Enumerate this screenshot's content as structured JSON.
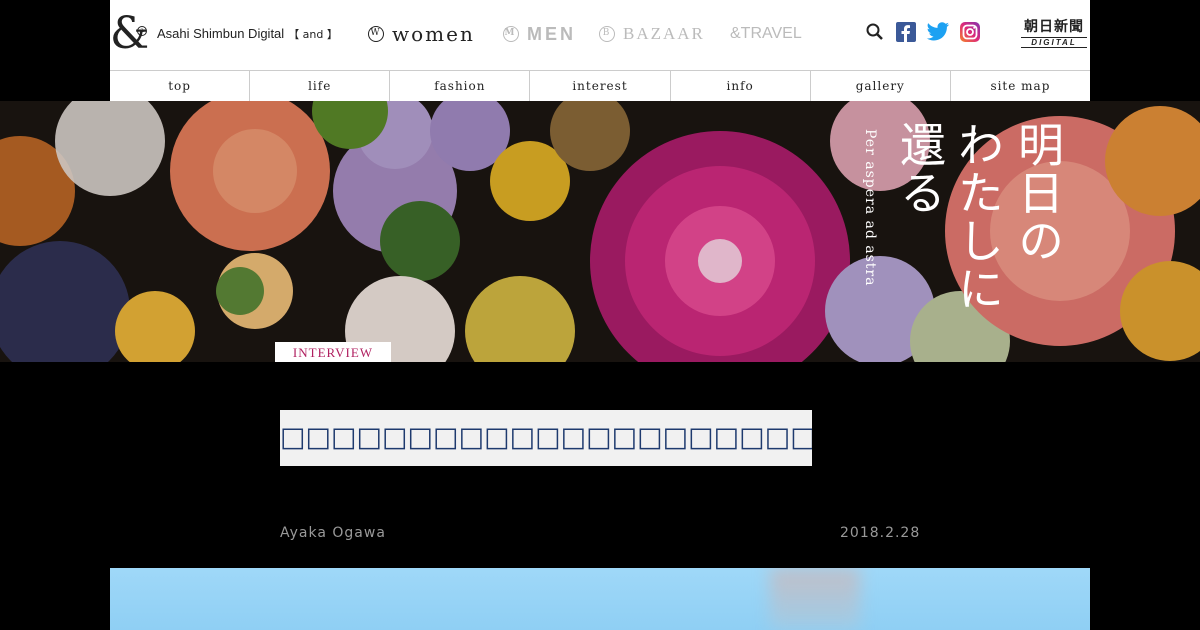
{
  "header": {
    "logo_glyph": "&",
    "logo_sub": "a",
    "brand": "Asahi Shimbun Digital",
    "brand_tag": "【 and 】",
    "sites": [
      {
        "label": "women",
        "badge": "W",
        "active": true
      },
      {
        "label": "MEN",
        "badge": "M",
        "active": false
      },
      {
        "label": "BAZAAR",
        "badge": "B",
        "active": false
      },
      {
        "label": "&TRAVEL",
        "active": false
      }
    ],
    "icons": [
      "search-icon",
      "facebook-icon",
      "twitter-icon",
      "instagram-icon"
    ],
    "asahi_logo": "朝日新聞",
    "asahi_sub": "DIGITAL"
  },
  "nav": {
    "items": [
      "top",
      "life",
      "fashion",
      "interest",
      "info",
      "gallery",
      "site map"
    ]
  },
  "hero": {
    "title_lines": [
      "明日の",
      "わたしに",
      "還る"
    ],
    "subtitle": "Per aspera ad astra",
    "tag": "INTERVIEW"
  },
  "article": {
    "headline": "□□□□□□□□□□□□□□□□□□□□□□□□□□□□□□□□□□□□□",
    "author": "Ayaka Ogawa",
    "date": "2018.2.28"
  },
  "colors": {
    "background": "#000000",
    "tag_text": "#b02060",
    "headline_text": "#1e3a6e",
    "meta_text": "#999999"
  }
}
